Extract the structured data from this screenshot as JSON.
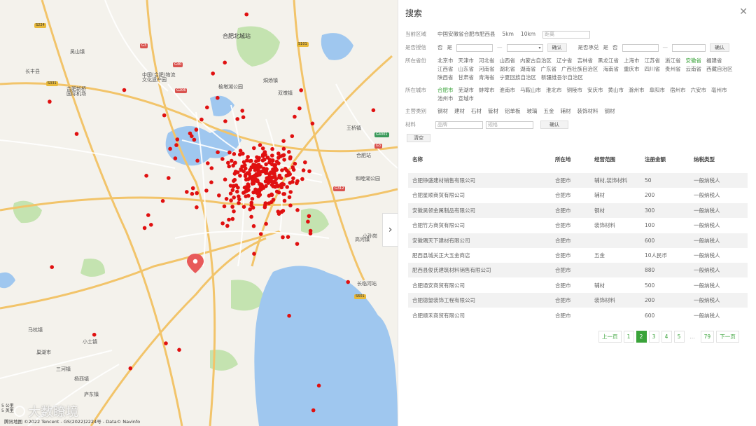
{
  "map": {
    "place_labels": [
      {
        "text": "合肥北城站",
        "big": true
      },
      {
        "text": "中国(合肥)物流\n文化遗产园",
        "big": false
      },
      {
        "text": "合肥新桥\n国际机场",
        "big": false
      },
      {
        "text": "榆墩湖公园",
        "big": false
      },
      {
        "text": "长临河站",
        "big": false
      },
      {
        "text": "合肥站",
        "big": false
      },
      {
        "text": "和睦湖公园",
        "big": false
      },
      {
        "text": "长丰县",
        "big": false
      },
      {
        "text": "吴山镇",
        "big": false
      },
      {
        "text": "小土镇",
        "big": false
      },
      {
        "text": "三河镇",
        "big": false
      },
      {
        "text": "马杭镇",
        "big": false
      },
      {
        "text": "王桥镇",
        "big": false
      },
      {
        "text": "高河镇",
        "big": false
      },
      {
        "text": "烔炀镇",
        "big": false
      },
      {
        "text": "小孙岗",
        "big": false
      },
      {
        "text": "巢湖市",
        "big": false
      },
      {
        "text": "杨西镇",
        "big": false
      },
      {
        "text": "双墩镇",
        "big": false
      },
      {
        "text": "庐东镇",
        "big": false
      }
    ],
    "road_badges": [
      {
        "text": "G3",
        "color": "red"
      },
      {
        "text": "S224",
        "color": "yellow"
      },
      {
        "text": "G40",
        "color": "red"
      },
      {
        "text": "S101",
        "color": "yellow"
      },
      {
        "text": "G206",
        "color": "red"
      },
      {
        "text": "G4001",
        "color": "green"
      },
      {
        "text": "G312",
        "color": "red"
      },
      {
        "text": "S331",
        "color": "yellow"
      },
      {
        "text": "G3",
        "color": "red"
      },
      {
        "text": "S601",
        "color": "yellow"
      }
    ],
    "toggle_icon": "chevron-right-icon",
    "toggle_glyph": "›",
    "watermark": "大数瞭境",
    "scale": "5 公里\n5 英里",
    "copyright": "腾讯地图 ©2022 Tencent - GS(2022)2224号 - Data© Navinfo"
  },
  "panel": {
    "title": "搜索",
    "close_glyph": "✕",
    "area": {
      "label": "当前区域",
      "value": "中国安徽省合肥市肥西县",
      "options": [
        "5km",
        "10km"
      ],
      "input_placeholder": "距离"
    },
    "export": {
      "label": "是否授信",
      "yes_label": "否",
      "no_label": "是",
      "confirm": "确认",
      "label2": "是否承兑",
      "yes2": "是",
      "no2": "否",
      "confirm2": "确认"
    },
    "province": {
      "label": "所在省份",
      "items": [
        "北京市",
        "天津市",
        "河北省",
        "山西省",
        "内蒙古自治区",
        "辽宁省",
        "吉林省",
        "黑龙江省",
        "上海市",
        "江苏省",
        "浙江省",
        "安徽省",
        "福建省",
        "江西省",
        "山东省",
        "河南省",
        "湖北省",
        "湖南省",
        "广东省",
        "广西壮族自治区",
        "海南省",
        "重庆市",
        "四川省",
        "贵州省",
        "云南省",
        "西藏自治区",
        "陕西省",
        "甘肃省",
        "青海省",
        "宁夏回族自治区",
        "新疆维吾尔自治区"
      ],
      "active": "安徽省"
    },
    "city": {
      "label": "所在城市",
      "items": [
        "合肥市",
        "芜湖市",
        "蚌埠市",
        "淮南市",
        "马鞍山市",
        "淮北市",
        "铜陵市",
        "安庆市",
        "黄山市",
        "滁州市",
        "阜阳市",
        "宿州市",
        "六安市",
        "亳州市",
        "池州市",
        "宣城市"
      ],
      "active": "合肥市"
    },
    "category": {
      "label": "主营类别",
      "items": [
        "钢材",
        "建材",
        "石材",
        "管材",
        "铝单板",
        "玻璃",
        "五金",
        "辅材",
        "装饰材料",
        "钢材"
      ]
    },
    "material": {
      "label": "材料",
      "placeholder1": "品牌",
      "placeholder2": "规格",
      "confirm": "确认"
    },
    "clear": "清空",
    "table": {
      "headers": [
        "名称",
        "所在地",
        "经营范围",
        "注册金额",
        "纳税类型"
      ],
      "rows": [
        [
          "合肥铮盛建材销售有限公司",
          "合肥市",
          "辅材,装饰材料",
          "50",
          "一般纳税人"
        ],
        [
          "合肥星顺商贸有限公司",
          "合肥市",
          "辅材",
          "200",
          "一般纳税人"
        ],
        [
          "安徽昊领金属制品有限公司",
          "合肥市",
          "钢材",
          "300",
          "一般纳税人"
        ],
        [
          "合肥竹方商贸有限公司",
          "合肥市",
          "装饰材料",
          "100",
          "一般纳税人"
        ],
        [
          "安徽隅天下建材有限公司",
          "合肥市",
          "",
          "600",
          "一般纳税人"
        ],
        [
          "肥西县城关正大五金商店",
          "合肥市",
          "五金",
          "10人民币",
          "一般纳税人"
        ],
        [
          "肥西县俊氏建筑材料销售有限公司",
          "合肥市",
          "",
          "880",
          "一般纳税人"
        ],
        [
          "合肥通安商贸有限公司",
          "合肥市",
          "辅材",
          "500",
          "一般纳税人"
        ],
        [
          "合肥德望装饰工程有限公司",
          "合肥市",
          "装饰材料",
          "200",
          "一般纳税人"
        ],
        [
          "合肥顺禾商贸有限公司",
          "合肥市",
          "",
          "600",
          "一般纳税人"
        ]
      ]
    },
    "pagination": {
      "prev": "上一页",
      "pages": [
        "1",
        "2",
        "3",
        "4",
        "5",
        "...",
        "79"
      ],
      "current": "2",
      "next": "下一页"
    }
  },
  "colors": {
    "accent": "#3aa33a",
    "marker": "#e01010",
    "water": "#9fc7ef",
    "park": "#c4e3b0",
    "road_major": "#f2c46a",
    "road_minor": "#ffffff"
  }
}
